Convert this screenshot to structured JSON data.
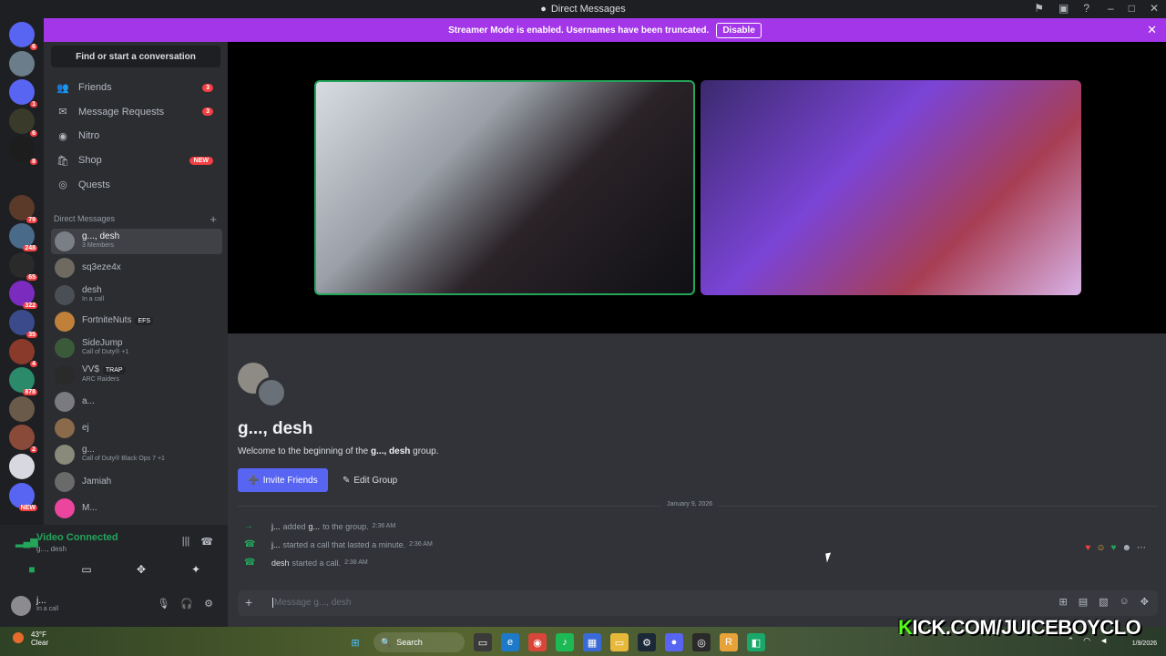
{
  "titlebar": {
    "title": "Direct Messages"
  },
  "banner": {
    "text": "Streamer Mode is enabled. Usernames have been truncated.",
    "button": "Disable"
  },
  "guilds": [
    {
      "color": "#5865f2",
      "badge": "6"
    },
    {
      "color": "#6b7c8a",
      "badge": ""
    },
    {
      "color": "#5865f2",
      "badge": "1"
    },
    {
      "color": "#3a3a2a",
      "badge": "6"
    },
    {
      "color": "#1d1d1d",
      "badge": "8"
    },
    {
      "color": "#1e1f22",
      "badge": ""
    },
    {
      "color": "#5b3a2a",
      "badge": "79"
    },
    {
      "color": "#4a6a8a",
      "badge": "248"
    },
    {
      "color": "#2a2a2a",
      "badge": "65"
    },
    {
      "color": "#7b2cbf",
      "badge": "322"
    },
    {
      "color": "#3a4a8a",
      "badge": "35"
    },
    {
      "color": "#8a3a2a",
      "badge": "4"
    },
    {
      "color": "#2a8a6a",
      "badge": "878"
    },
    {
      "color": "#6a5a4a",
      "badge": ""
    },
    {
      "color": "#8a4a3a",
      "badge": "2"
    },
    {
      "color": "#d8d8e0",
      "badge": ""
    },
    {
      "color": "#5865f2",
      "badge": "NEW"
    }
  ],
  "sidebar": {
    "find": "Find or start a conversation",
    "nav": [
      {
        "icon": "friends-icon",
        "glyph": "👥",
        "label": "Friends",
        "count": "3"
      },
      {
        "icon": "envelope-icon",
        "glyph": "✉",
        "label": "Message Requests",
        "count": "3"
      },
      {
        "icon": "nitro-icon",
        "glyph": "◉",
        "label": "Nitro",
        "count": ""
      },
      {
        "icon": "shop-icon",
        "glyph": "🛍",
        "label": "Shop",
        "count": ""
      },
      {
        "icon": "quests-icon",
        "glyph": "◎",
        "label": "Quests",
        "count": ""
      }
    ],
    "shop_badge": "NEW",
    "dm_header": "Direct Messages",
    "dms": [
      {
        "name": "g..., desh",
        "sub": "3 Members",
        "color": "#7a7f86",
        "tag": ""
      },
      {
        "name": "sq3eze4x",
        "sub": "",
        "color": "#6e6a60",
        "tag": ""
      },
      {
        "name": "desh",
        "sub": "In a call",
        "color": "#4a4e55",
        "tag": ""
      },
      {
        "name": "FortniteNuts",
        "sub": "",
        "color": "#c0803a",
        "tag": "EFS"
      },
      {
        "name": "SideJump",
        "sub": "Call of Duty® +1",
        "color": "#3a5a3a",
        "tag": ""
      },
      {
        "name": "VV$",
        "sub": "ARC Raiders",
        "color": "#2a2a2a",
        "tag": "TRAP"
      },
      {
        "name": "a...",
        "sub": "",
        "color": "#7a7a80",
        "tag": ""
      },
      {
        "name": "ej",
        "sub": "",
        "color": "#8a6a4a",
        "tag": ""
      },
      {
        "name": "g...",
        "sub": "Call of Duty® Black Ops 7 +1",
        "color": "#8a8a7a",
        "tag": ""
      },
      {
        "name": "Jamiah",
        "sub": "",
        "color": "#6a6a6a",
        "tag": ""
      },
      {
        "name": "M...",
        "sub": "",
        "color": "#eb459e",
        "tag": ""
      }
    ]
  },
  "voice": {
    "status": "Video Connected",
    "group": "g..., desh"
  },
  "user": {
    "name": "j...",
    "status": "In a call"
  },
  "chat": {
    "group_name": "g..., desh",
    "welcome_prefix": "Welcome to the beginning of the",
    "welcome_name": "g..., desh",
    "welcome_suffix": "group.",
    "invite_btn": "Invite Friends",
    "edit_btn": "Edit Group",
    "date": "January 9, 2026",
    "messages": [
      {
        "who": "j...",
        "text": "added",
        "target": "g...",
        "rest": "to the group.",
        "ts": "2:36 AM"
      },
      {
        "who": "j...",
        "text": "started a call that lasted a minute.",
        "target": "",
        "rest": "",
        "ts": "2:36 AM"
      },
      {
        "who": "desh",
        "text": "started a call.",
        "target": "",
        "rest": "",
        "ts": "2:38 AM"
      }
    ],
    "input_placeholder": "Message g..., desh"
  },
  "taskbar": {
    "temp": "43°F",
    "cond": "Clear",
    "search": "Search",
    "date": "1/9/2026"
  },
  "overlay": {
    "kick_k": "K",
    "kick_rest": "ICK.COM/JUICEBOYCLO"
  }
}
